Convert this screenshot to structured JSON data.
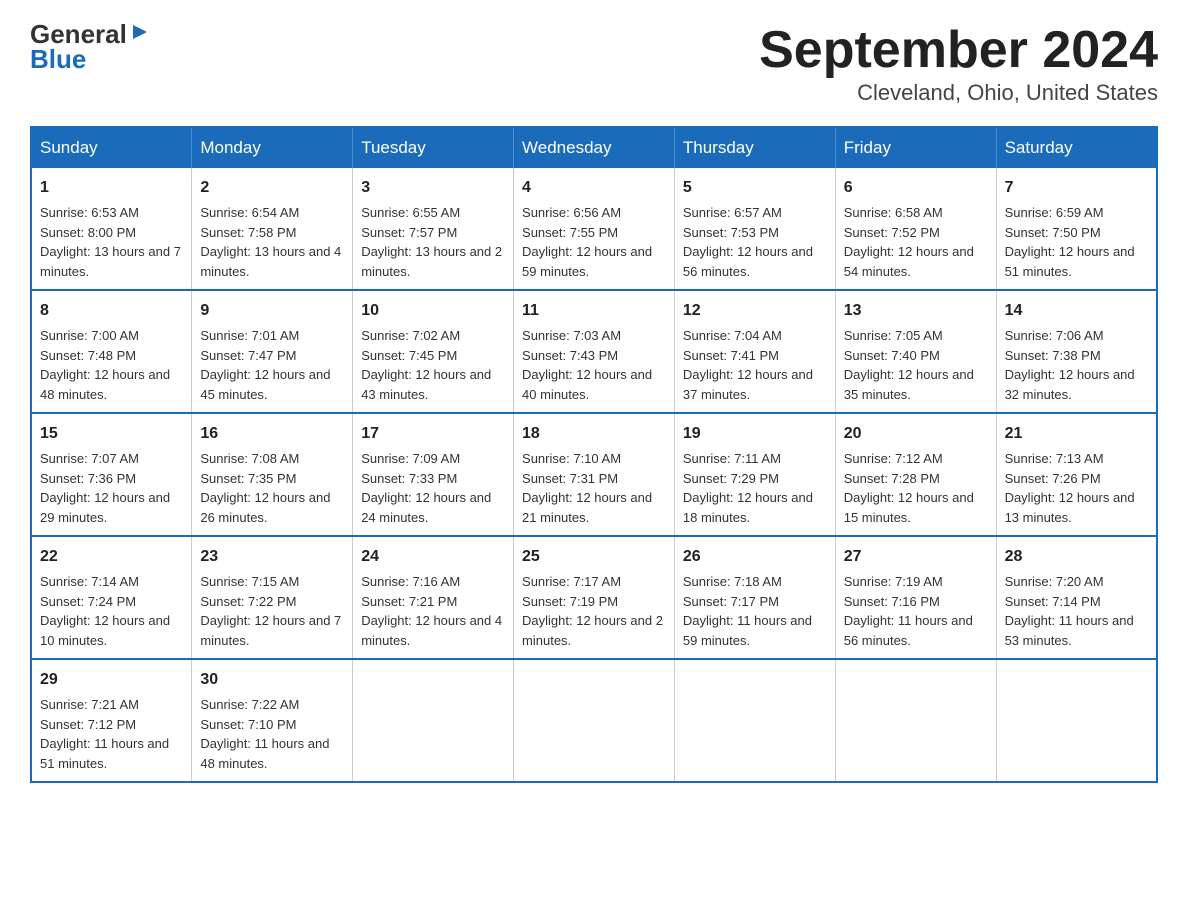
{
  "logo": {
    "line1": "General",
    "triangle": "▶",
    "line2": "Blue"
  },
  "title": "September 2024",
  "subtitle": "Cleveland, Ohio, United States",
  "days_header": [
    "Sunday",
    "Monday",
    "Tuesday",
    "Wednesday",
    "Thursday",
    "Friday",
    "Saturday"
  ],
  "weeks": [
    [
      {
        "day": "1",
        "sunrise": "6:53 AM",
        "sunset": "8:00 PM",
        "daylight": "13 hours and 7 minutes."
      },
      {
        "day": "2",
        "sunrise": "6:54 AM",
        "sunset": "7:58 PM",
        "daylight": "13 hours and 4 minutes."
      },
      {
        "day": "3",
        "sunrise": "6:55 AM",
        "sunset": "7:57 PM",
        "daylight": "13 hours and 2 minutes."
      },
      {
        "day": "4",
        "sunrise": "6:56 AM",
        "sunset": "7:55 PM",
        "daylight": "12 hours and 59 minutes."
      },
      {
        "day": "5",
        "sunrise": "6:57 AM",
        "sunset": "7:53 PM",
        "daylight": "12 hours and 56 minutes."
      },
      {
        "day": "6",
        "sunrise": "6:58 AM",
        "sunset": "7:52 PM",
        "daylight": "12 hours and 54 minutes."
      },
      {
        "day": "7",
        "sunrise": "6:59 AM",
        "sunset": "7:50 PM",
        "daylight": "12 hours and 51 minutes."
      }
    ],
    [
      {
        "day": "8",
        "sunrise": "7:00 AM",
        "sunset": "7:48 PM",
        "daylight": "12 hours and 48 minutes."
      },
      {
        "day": "9",
        "sunrise": "7:01 AM",
        "sunset": "7:47 PM",
        "daylight": "12 hours and 45 minutes."
      },
      {
        "day": "10",
        "sunrise": "7:02 AM",
        "sunset": "7:45 PM",
        "daylight": "12 hours and 43 minutes."
      },
      {
        "day": "11",
        "sunrise": "7:03 AM",
        "sunset": "7:43 PM",
        "daylight": "12 hours and 40 minutes."
      },
      {
        "day": "12",
        "sunrise": "7:04 AM",
        "sunset": "7:41 PM",
        "daylight": "12 hours and 37 minutes."
      },
      {
        "day": "13",
        "sunrise": "7:05 AM",
        "sunset": "7:40 PM",
        "daylight": "12 hours and 35 minutes."
      },
      {
        "day": "14",
        "sunrise": "7:06 AM",
        "sunset": "7:38 PM",
        "daylight": "12 hours and 32 minutes."
      }
    ],
    [
      {
        "day": "15",
        "sunrise": "7:07 AM",
        "sunset": "7:36 PM",
        "daylight": "12 hours and 29 minutes."
      },
      {
        "day": "16",
        "sunrise": "7:08 AM",
        "sunset": "7:35 PM",
        "daylight": "12 hours and 26 minutes."
      },
      {
        "day": "17",
        "sunrise": "7:09 AM",
        "sunset": "7:33 PM",
        "daylight": "12 hours and 24 minutes."
      },
      {
        "day": "18",
        "sunrise": "7:10 AM",
        "sunset": "7:31 PM",
        "daylight": "12 hours and 21 minutes."
      },
      {
        "day": "19",
        "sunrise": "7:11 AM",
        "sunset": "7:29 PM",
        "daylight": "12 hours and 18 minutes."
      },
      {
        "day": "20",
        "sunrise": "7:12 AM",
        "sunset": "7:28 PM",
        "daylight": "12 hours and 15 minutes."
      },
      {
        "day": "21",
        "sunrise": "7:13 AM",
        "sunset": "7:26 PM",
        "daylight": "12 hours and 13 minutes."
      }
    ],
    [
      {
        "day": "22",
        "sunrise": "7:14 AM",
        "sunset": "7:24 PM",
        "daylight": "12 hours and 10 minutes."
      },
      {
        "day": "23",
        "sunrise": "7:15 AM",
        "sunset": "7:22 PM",
        "daylight": "12 hours and 7 minutes."
      },
      {
        "day": "24",
        "sunrise": "7:16 AM",
        "sunset": "7:21 PM",
        "daylight": "12 hours and 4 minutes."
      },
      {
        "day": "25",
        "sunrise": "7:17 AM",
        "sunset": "7:19 PM",
        "daylight": "12 hours and 2 minutes."
      },
      {
        "day": "26",
        "sunrise": "7:18 AM",
        "sunset": "7:17 PM",
        "daylight": "11 hours and 59 minutes."
      },
      {
        "day": "27",
        "sunrise": "7:19 AM",
        "sunset": "7:16 PM",
        "daylight": "11 hours and 56 minutes."
      },
      {
        "day": "28",
        "sunrise": "7:20 AM",
        "sunset": "7:14 PM",
        "daylight": "11 hours and 53 minutes."
      }
    ],
    [
      {
        "day": "29",
        "sunrise": "7:21 AM",
        "sunset": "7:12 PM",
        "daylight": "11 hours and 51 minutes."
      },
      {
        "day": "30",
        "sunrise": "7:22 AM",
        "sunset": "7:10 PM",
        "daylight": "11 hours and 48 minutes."
      },
      null,
      null,
      null,
      null,
      null
    ]
  ]
}
